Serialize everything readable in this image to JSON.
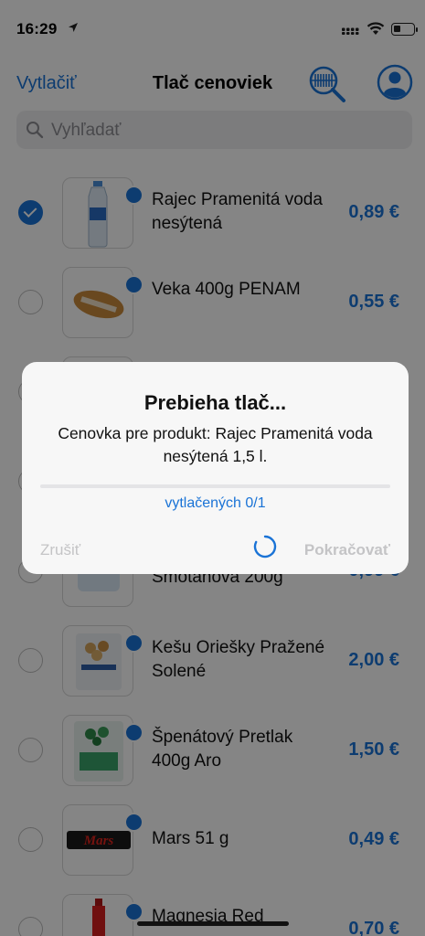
{
  "status_bar": {
    "time": "16:29"
  },
  "nav": {
    "left_button": "Vytlačiť",
    "title": "Tlač cenoviek"
  },
  "search": {
    "placeholder": "Vyhľadať"
  },
  "products": [
    {
      "name": "Rajec Pramenitá voda nesýtená",
      "price": "0,89 €",
      "checked": true
    },
    {
      "name": "Veka 400g PENAM",
      "price": "0,55 €",
      "checked": false
    },
    {
      "name": "",
      "price": "",
      "checked": false
    },
    {
      "name": "",
      "price": "",
      "checked": false
    },
    {
      "name": "Smotanová 200g",
      "price": "0,99 €",
      "checked": false
    },
    {
      "name": "Kešu Oriešky Pražené Solené",
      "price": "2,00 €",
      "checked": false
    },
    {
      "name": "Špenátový Pretlak 400g Aro",
      "price": "1,50 €",
      "checked": false
    },
    {
      "name": "Mars 51 g",
      "price": "0,49 €",
      "checked": false
    },
    {
      "name": "Magnesia Red",
      "price": "0,70 €",
      "checked": false
    }
  ],
  "dialog": {
    "title": "Prebieha tlač...",
    "message": "Cenovka pre produkt: Rajec Pramenitá voda nesýtená 1,5 l.",
    "progress_label": "vytlačených 0/1",
    "progress_fraction": 0,
    "cancel_label": "Zrušiť",
    "continue_label": "Pokračovať"
  },
  "colors": {
    "accent": "#1a73d6",
    "disabled": "#c4c4c6"
  }
}
